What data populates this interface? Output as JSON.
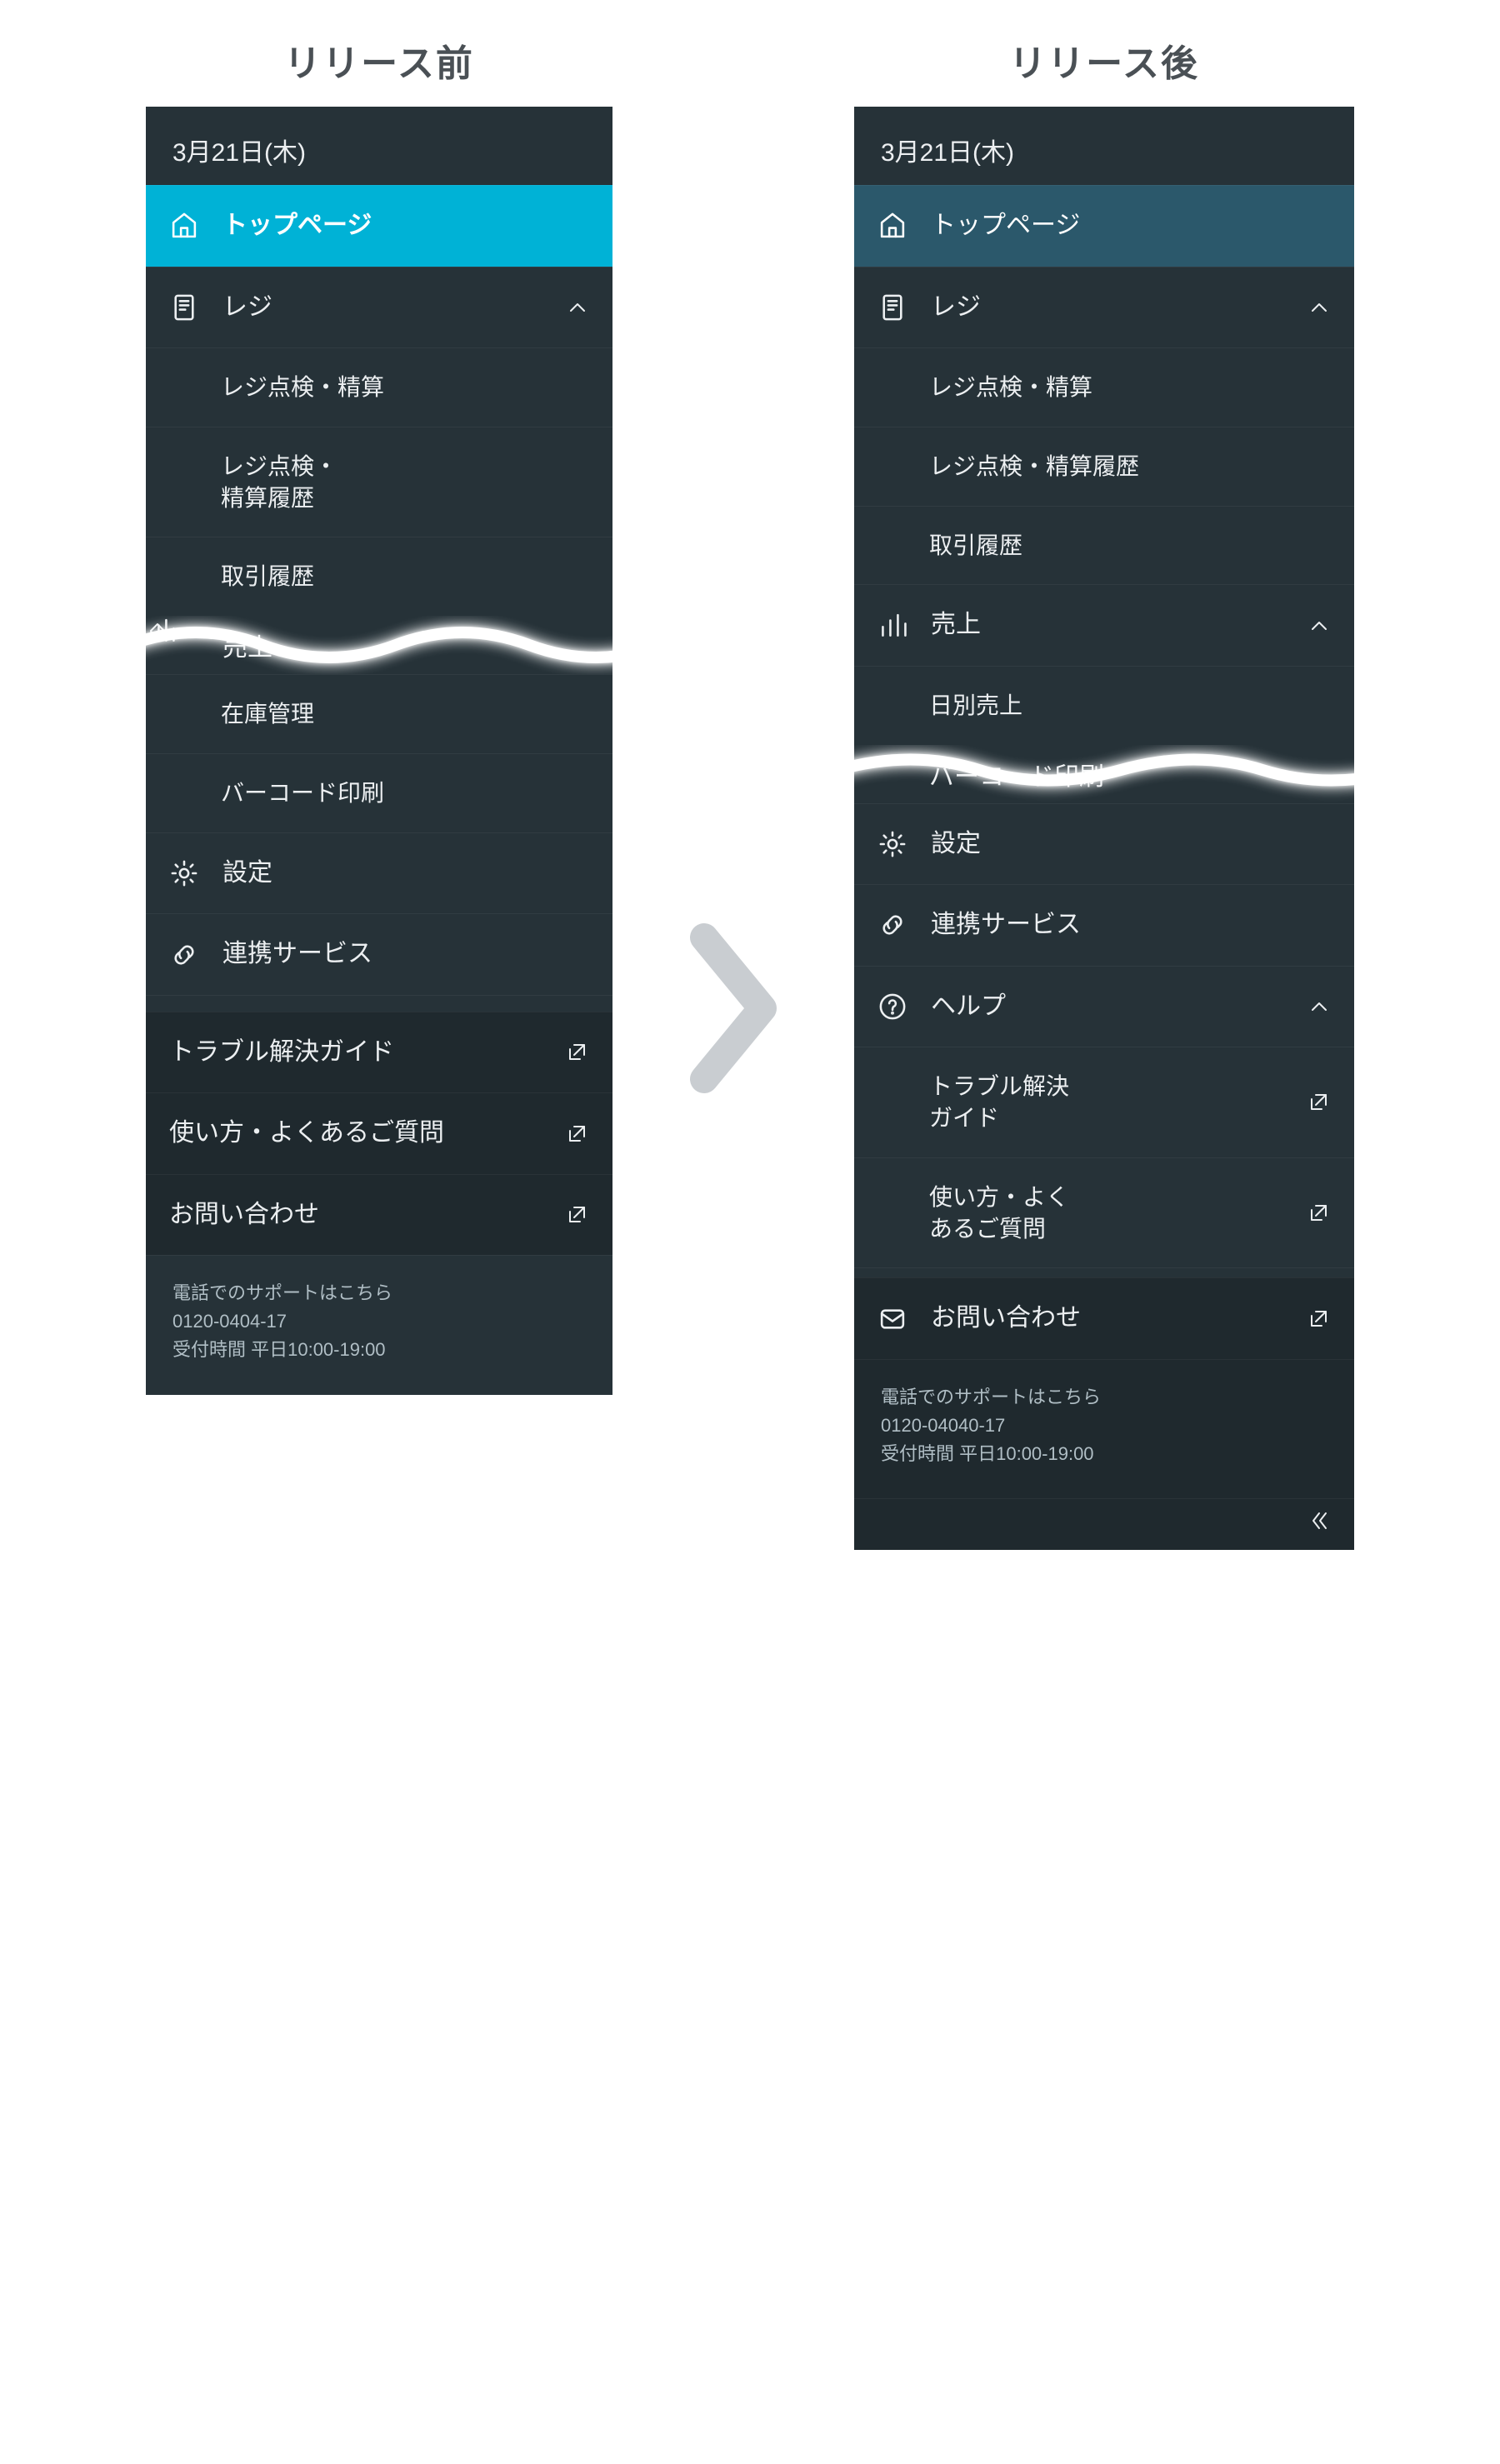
{
  "titles": {
    "before": "リリース前",
    "after": "リリース後"
  },
  "date": "3月21日(木)",
  "before": {
    "top": "トップページ",
    "reg": "レジ",
    "reg_check": "レジ点検・精算",
    "reg_hist": "レジ点検・\n精算履歴",
    "trans": "取引履歴",
    "sales": "売上",
    "stock": "在庫管理",
    "barcode": "バーコード印刷",
    "settings": "設定",
    "linked": "連携サービス",
    "trouble": "トラブル解決ガイド",
    "faq": "使い方・よくあるご質問",
    "contact": "お問い合わせ",
    "support_l1": "電話でのサポートはこちら",
    "support_l2": "0120-0404-17",
    "support_l3": "受付時間 平日10:00-19:00"
  },
  "after": {
    "top": "トップページ",
    "reg": "レジ",
    "reg_check": "レジ点検・精算",
    "reg_hist": "レジ点検・精算履歴",
    "trans": "取引履歴",
    "sales": "売上",
    "sales_daily": "日別売上",
    "barcode": "バーコード印刷",
    "settings": "設定",
    "linked": "連携サービス",
    "help": "ヘルプ",
    "trouble": "トラブル解決\nガイド",
    "faq": "使い方・よく\nあるご質問",
    "contact": "お問い合わせ",
    "support_l1": "電話でのサポートはこちら",
    "support_l2": "0120-04040-17",
    "support_l3": "受付時間 平日10:00-19:00"
  }
}
